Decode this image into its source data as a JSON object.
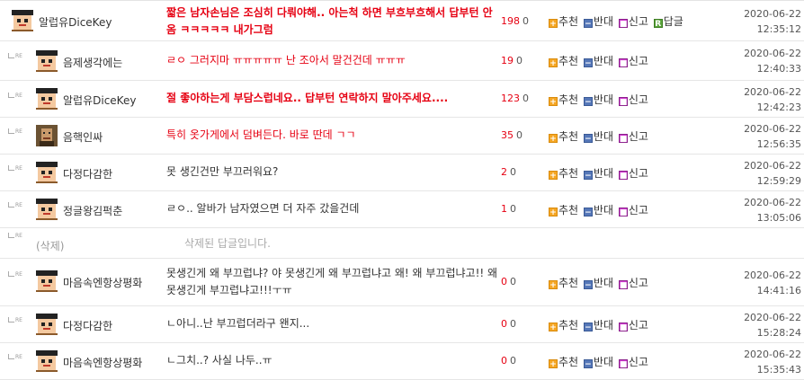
{
  "action_labels": {
    "recommend": "추천",
    "oppose": "반대",
    "report": "신고",
    "reply": "답글"
  },
  "icons": {
    "plus": "+",
    "minus": "−",
    "report": "■",
    "reply": "R"
  },
  "reply_marker": "RE",
  "comments": [
    {
      "nick": "알럽유DiceKey",
      "text": "짧은 남자손님은 조심히 다뤄야해.. 아는척 하면 부흐부흐해서 답부턴 안옴 ㅋㅋㅋㅋㅋ 내가그럼",
      "up": "198",
      "down": "0",
      "date": "2020-06-22",
      "time": "12:35:12"
    },
    {
      "nick": "음제생각에는",
      "text": "ㄹㅇ 그러지마 ㅠㅠㅠㅠㅠ 난 조아서 말건건데 ㅠㅠㅠ",
      "up": "19",
      "down": "0",
      "date": "2020-06-22",
      "time": "12:40:33"
    },
    {
      "nick": "알럽유DiceKey",
      "text": "절 좋아하는게 부담스럽네요.. 답부턴 연락하지 말아주세요....",
      "up": "123",
      "down": "0",
      "date": "2020-06-22",
      "time": "12:42:23"
    },
    {
      "nick": "음핵인싸",
      "text": "특히 옷가게에서 덤벼든다. 바로 딴데 ㄱㄱ",
      "up": "35",
      "down": "0",
      "date": "2020-06-22",
      "time": "12:56:35"
    },
    {
      "nick": "다정다감한",
      "text": "못 생긴건만 부끄러워요?",
      "up": "2",
      "down": "0",
      "date": "2020-06-22",
      "time": "12:59:29"
    },
    {
      "nick": "정글왕김퍽춘",
      "text": "ㄹㅇ.. 알바가 남자였으면 더 자주 갔을건데",
      "up": "1",
      "down": "0",
      "date": "2020-06-22",
      "time": "13:05:06"
    },
    {
      "nick": "(삭제)",
      "text": "삭제된 답글입니다."
    },
    {
      "nick": "마음속엔항상평화",
      "text": "못생긴게 왜 부끄럽냐? 야 못생긴게 왜 부끄럽냐고 왜! 왜 부끄럽냐고!! 왜 못생긴게 부끄럽냐고!!!ㅜㅠ",
      "up": "0",
      "down": "0",
      "date": "2020-06-22",
      "time": "14:41:16"
    },
    {
      "nick": "다정다감한",
      "text": "ㄴ아니..난 부끄럽더라구 왠지...",
      "up": "0",
      "down": "0",
      "date": "2020-06-22",
      "time": "15:28:24"
    },
    {
      "nick": "마음속엔항상평화",
      "text": "ㄴ그치..? 사실 나두..ㅠ",
      "up": "0",
      "down": "0",
      "date": "2020-06-22",
      "time": "15:35:43"
    }
  ]
}
